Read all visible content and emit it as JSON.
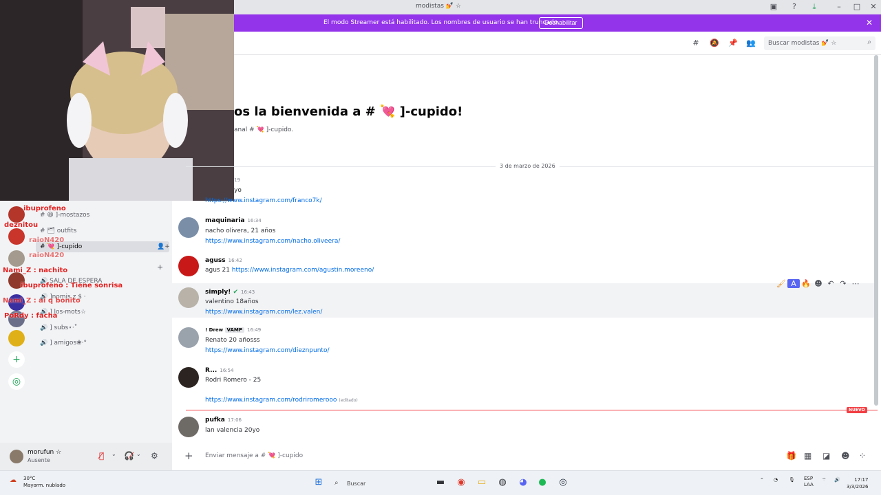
{
  "window": {
    "title": "modistas 💅 ☆"
  },
  "streamer_banner": {
    "message": "El modo Streamer está habilitado. Los nombres de usuario se han truncado.",
    "button": "Deshabilitar",
    "close": "✕"
  },
  "header": {
    "search_placeholder": "Buscar modistas 💅 ☆"
  },
  "sidebar": {
    "channels": [
      {
        "label": "# 😆 ]-mostazos"
      },
      {
        "label": "# 🗂 outfits"
      },
      {
        "label": "# 💘 ]-cupido"
      },
      {
        "label": "🔊 SALA DE ESPERA"
      },
      {
        "label": "🔊 ]nomis z $ ·"
      },
      {
        "label": "🔊 ] los-mots☆"
      },
      {
        "label": "🔊 ] subs⋆·˚"
      },
      {
        "label": "🔊 ] amigos❀·°"
      }
    ],
    "stream_overlay": [
      {
        "text": "ibuprofeno"
      },
      {
        "text": "deznitou"
      },
      {
        "text": "raioN420"
      },
      {
        "text": "raioN420"
      },
      {
        "text": "Nami_Z : nachito"
      },
      {
        "text": "ibuprofeno : Tiene sonrisa"
      },
      {
        "text": "Nami_Z : ai q bonito"
      },
      {
        "text": "PoRdy : facha"
      }
    ]
  },
  "user_panel": {
    "name": "morufun ☆",
    "status": "Ausente"
  },
  "channel_intro": {
    "title": "os la bienvenida a # 💘 ]-cupido!",
    "subtitle": "anal # 💘 ]-cupido."
  },
  "date_divider": "3 de marzo de 2026",
  "messages": [
    {
      "author": "",
      "time": "",
      "lines": [
        "https://www.instagram.com/franco7k/"
      ],
      "partial_time": "19",
      "partial_text": "yo"
    },
    {
      "author": "maquinaria",
      "time": "16:34",
      "lines": [
        "nacho olivera, 21 años",
        "https://www.instagram.com/nacho.oliveera/"
      ]
    },
    {
      "author": "aguss",
      "time": "16:42",
      "prefix": "agus 21 ",
      "link": "https://www.instagram.com/agustin.moreeno/"
    },
    {
      "author": "simply!",
      "time": "16:43",
      "lines": [
        "valentino 18años",
        "https://www.instagram.com/lez.valen/"
      ]
    },
    {
      "author": "! Drew",
      "tag": "VAMP",
      "time": "16:49",
      "lines": [
        "Renato 20 añosss",
        "https://www.instagram.com/dieznpunto/"
      ]
    },
    {
      "author": "R...",
      "time": "16:54",
      "lines": [
        "Rodri Romero - 25",
        "https://www.instagram.com/rodriromerooo"
      ],
      "edited": "(editado)"
    },
    {
      "author": "pufka",
      "time": "17:06",
      "lines": [
        "lan valencia 20yo"
      ]
    }
  ],
  "new_badge": "NUEVO",
  "composer": {
    "placeholder": "Enviar mensaje a # 💘 ]-cupido"
  },
  "taskbar": {
    "weather_temp": "30°C",
    "weather_desc": "Mayorm. nublado",
    "search": "Buscar",
    "lang": "ESP",
    "lang2": "LAA",
    "time": "17:17",
    "date": "3/3/2026"
  }
}
